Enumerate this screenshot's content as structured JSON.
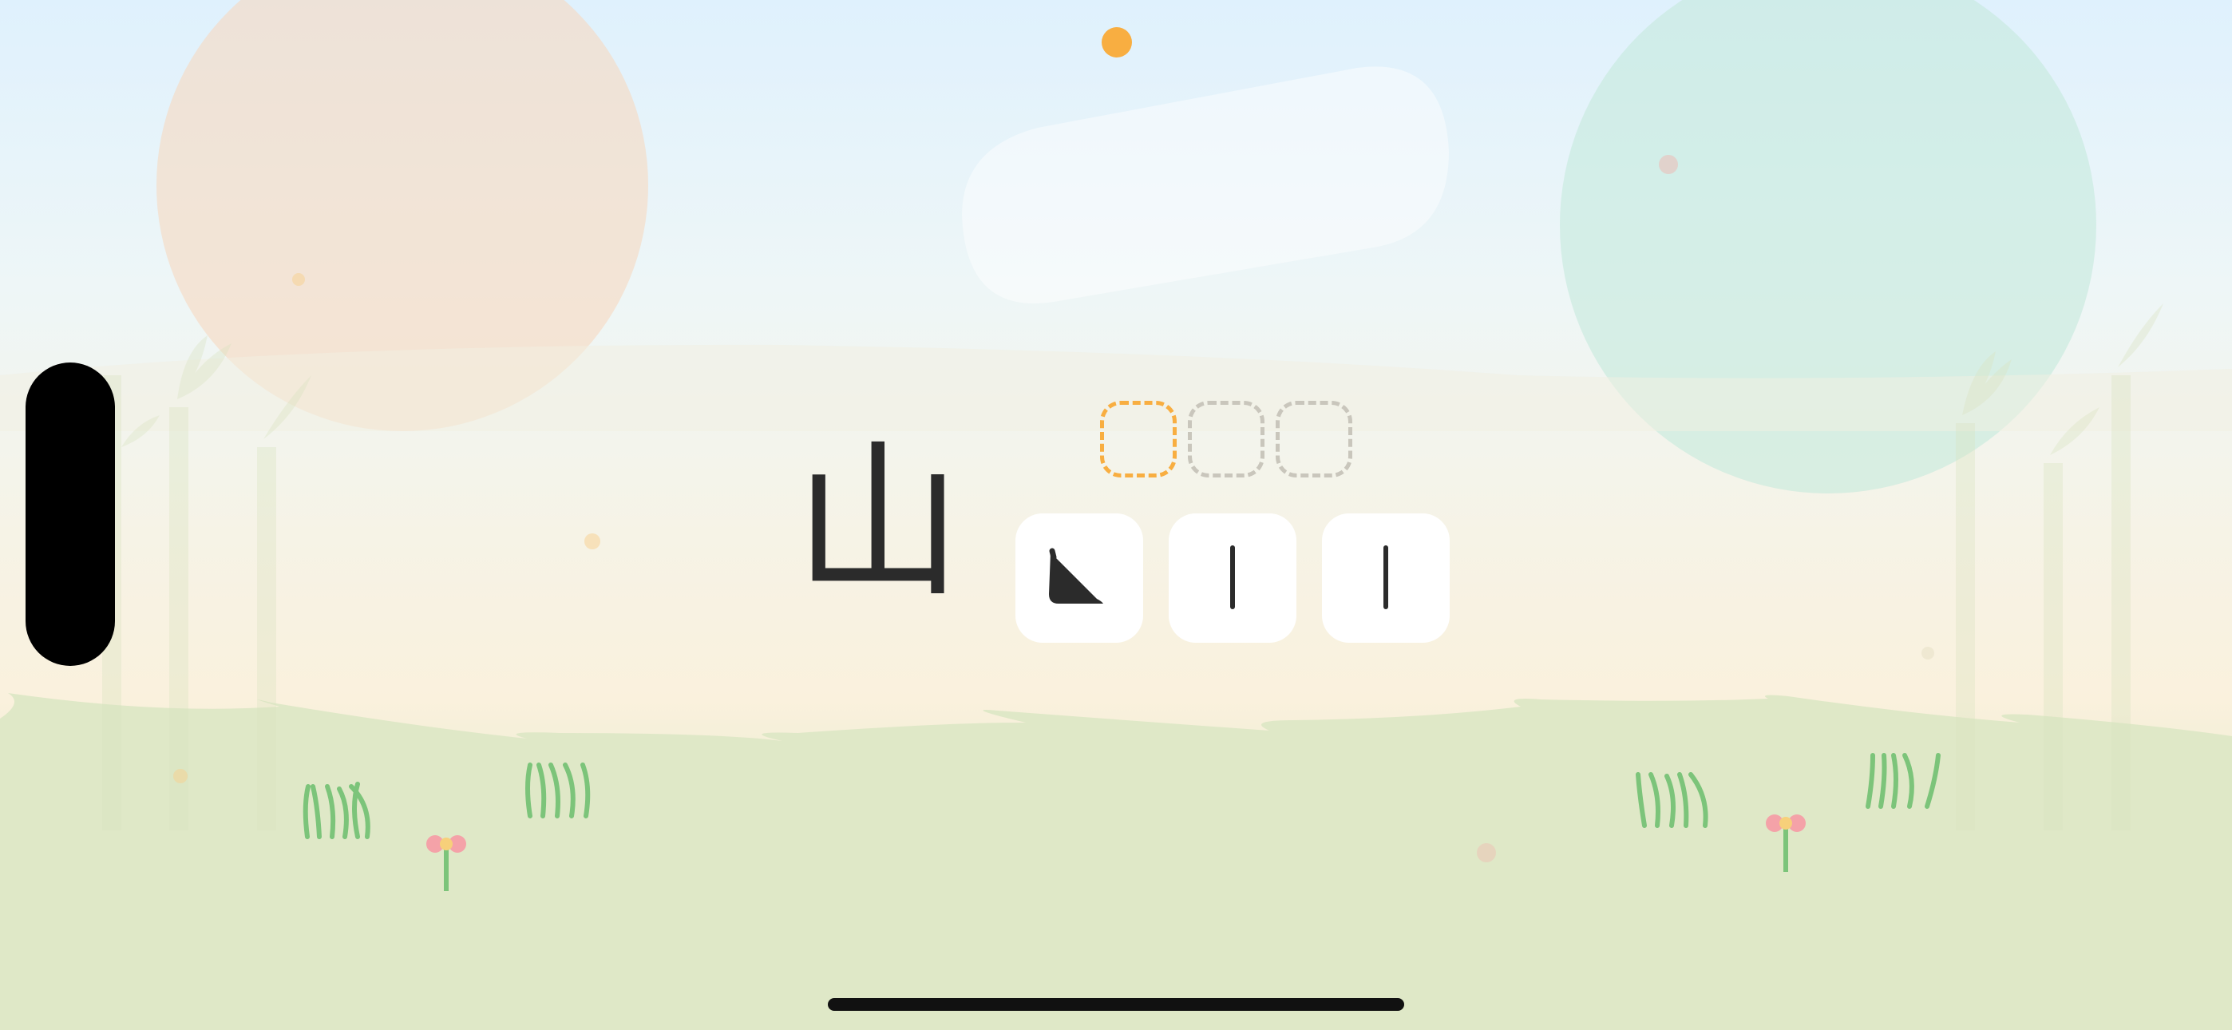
{
  "game": {
    "target_character": "山",
    "stroke_slots": [
      {
        "state": "active"
      },
      {
        "state": "empty"
      },
      {
        "state": "empty"
      }
    ],
    "stroke_tiles": [
      {
        "icon": "vertical-turn-stroke-icon"
      },
      {
        "icon": "vertical-stroke-icon"
      },
      {
        "icon": "vertical-stroke-icon"
      }
    ]
  },
  "colors": {
    "accent": "#f8ae41",
    "ink": "#2b2b2b",
    "slot_empty": "#c9c6bc",
    "tile": "#ffffff",
    "grass": "#7cc47a",
    "flower": "#f4a2a8"
  }
}
